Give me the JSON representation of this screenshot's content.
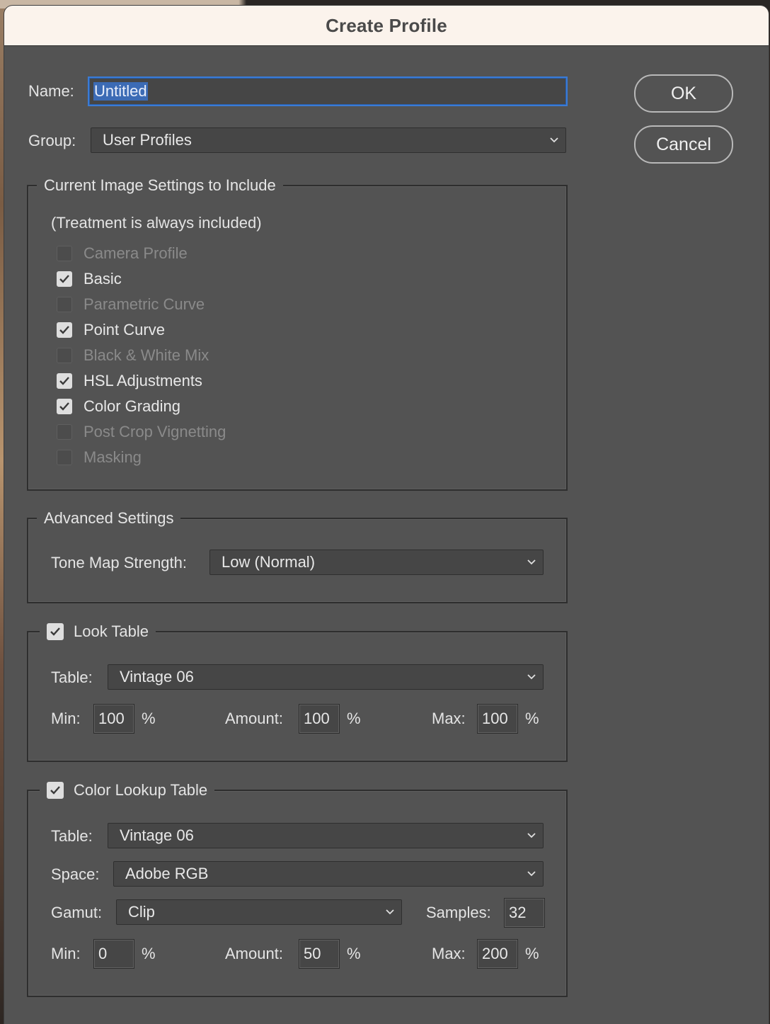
{
  "dialog": {
    "title": "Create Profile",
    "ok_label": "OK",
    "cancel_label": "Cancel"
  },
  "name": {
    "label": "Name:",
    "value": "Untitled"
  },
  "group": {
    "label": "Group:",
    "value": "User Profiles"
  },
  "settings": {
    "legend": "Current Image Settings to Include",
    "note": "(Treatment is always included)",
    "items": [
      {
        "label": "Camera Profile",
        "checked": false,
        "enabled": false
      },
      {
        "label": "Basic",
        "checked": true,
        "enabled": true
      },
      {
        "label": "Parametric Curve",
        "checked": false,
        "enabled": false
      },
      {
        "label": "Point Curve",
        "checked": true,
        "enabled": true
      },
      {
        "label": "Black & White Mix",
        "checked": false,
        "enabled": false
      },
      {
        "label": "HSL Adjustments",
        "checked": true,
        "enabled": true
      },
      {
        "label": "Color Grading",
        "checked": true,
        "enabled": true
      },
      {
        "label": "Post Crop Vignetting",
        "checked": false,
        "enabled": false
      },
      {
        "label": "Masking",
        "checked": false,
        "enabled": false
      }
    ]
  },
  "advanced": {
    "legend": "Advanced Settings",
    "tone_map_label": "Tone Map Strength:",
    "tone_map_value": "Low (Normal)"
  },
  "look_table": {
    "legend": "Look Table",
    "checked": true,
    "table_label": "Table:",
    "table_value": "Vintage 06",
    "min_label": "Min:",
    "min_value": "100",
    "amount_label": "Amount:",
    "amount_value": "100",
    "max_label": "Max:",
    "max_value": "100",
    "percent": "%"
  },
  "color_lookup": {
    "legend": "Color Lookup Table",
    "checked": true,
    "table_label": "Table:",
    "table_value": "Vintage 06",
    "space_label": "Space:",
    "space_value": "Adobe RGB",
    "gamut_label": "Gamut:",
    "gamut_value": "Clip",
    "samples_label": "Samples:",
    "samples_value": "32",
    "min_label": "Min:",
    "min_value": "0",
    "amount_label": "Amount:",
    "amount_value": "50",
    "max_label": "Max:",
    "max_value": "200",
    "percent": "%"
  },
  "icons": {
    "checkmark": "checkmark-icon",
    "dropdown": "chevron-down-icon"
  }
}
